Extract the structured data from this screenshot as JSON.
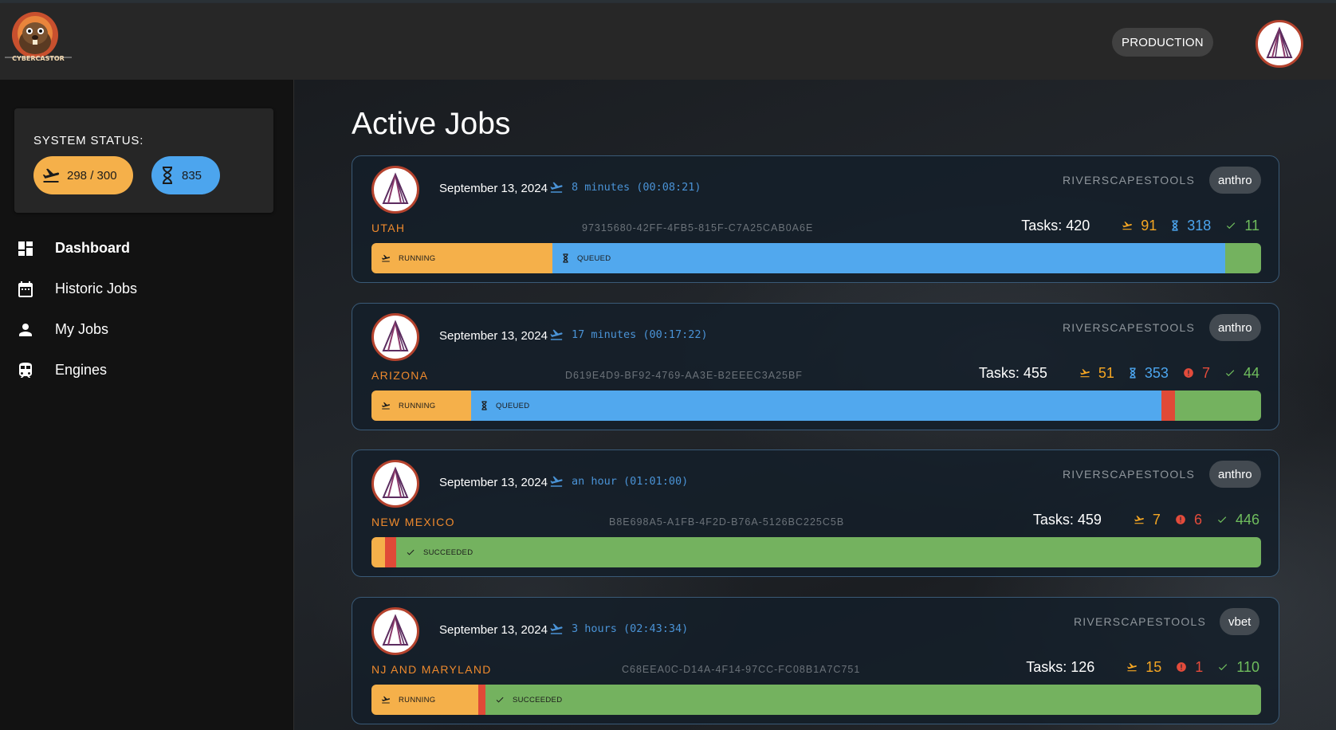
{
  "app": {
    "logo_text": "CYBERCASTOR",
    "environment": "PRODUCTION"
  },
  "colors": {
    "running": "#f5b04a",
    "queued": "#51a8ee",
    "failed": "#e04a37",
    "succeeded": "#74b25f",
    "job_name": "#ef8a2d"
  },
  "sidebar": {
    "status_title": "SYSTEM STATUS:",
    "running_chip": "298 / 300",
    "queued_chip": "835",
    "nav": [
      {
        "label": "Dashboard",
        "icon": "dashboard-icon",
        "active": true
      },
      {
        "label": "Historic Jobs",
        "icon": "calendar-icon",
        "active": false
      },
      {
        "label": "My Jobs",
        "icon": "person-icon",
        "active": false
      },
      {
        "label": "Engines",
        "icon": "train-icon",
        "active": false
      }
    ]
  },
  "main": {
    "title": "Active Jobs",
    "jobs": [
      {
        "date": "September 13, 2024",
        "runtime": "8 minutes (00:08:21)",
        "org": "RIVERSCAPESTOOLS",
        "tag": "anthro",
        "name": "UTAH",
        "id": "97315680-42FF-4FB5-815F-C7A25CAB0A6E",
        "tasks": "Tasks: 420",
        "running": "91",
        "queued": "318",
        "succeeded": "11",
        "bar_labels": {
          "running": "RUNNING",
          "queued": "QUEUED"
        }
      },
      {
        "date": "September 13, 2024",
        "runtime": "17 minutes (00:17:22)",
        "org": "RIVERSCAPESTOOLS",
        "tag": "anthro",
        "name": "ARIZONA",
        "id": "D619E4D9-BF92-4769-AA3E-B2EEEC3A25BF",
        "tasks": "Tasks: 455",
        "running": "51",
        "queued": "353",
        "failed": "7",
        "succeeded": "44",
        "bar_labels": {
          "running": "RUNNING",
          "queued": "QUEUED"
        }
      },
      {
        "date": "September 13, 2024",
        "runtime": "an hour (01:01:00)",
        "org": "RIVERSCAPESTOOLS",
        "tag": "anthro",
        "name": "NEW MEXICO",
        "id": "B8E698A5-A1FB-4F2D-B76A-5126BC225C5B",
        "tasks": "Tasks: 459",
        "running": "7",
        "failed": "6",
        "succeeded": "446",
        "bar_labels": {
          "succeeded": "SUCCEEDED"
        }
      },
      {
        "date": "September 13, 2024",
        "runtime": "3 hours (02:43:34)",
        "org": "RIVERSCAPESTOOLS",
        "tag": "vbet",
        "name": "NJ AND MARYLAND",
        "id": "C68EEA0C-D14A-4F14-97CC-FC08B1A7C751",
        "tasks": "Tasks: 126",
        "running": "15",
        "failed": "1",
        "succeeded": "110",
        "bar_labels": {
          "running": "RUNNING",
          "succeeded": "SUCCEEDED"
        }
      }
    ]
  }
}
